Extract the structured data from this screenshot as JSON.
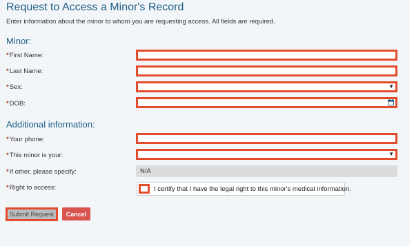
{
  "page": {
    "title": "Request to Access a Minor's Record",
    "intro": "Enter information about the minor to whom you are requesting access. All fields are required."
  },
  "minor_section": {
    "title": "Minor:",
    "required_mark": "*",
    "first_name_label": "First Name:",
    "first_name_value": "",
    "last_name_label": "Last Name:",
    "last_name_value": "",
    "sex_label": "Sex:",
    "sex_value": "",
    "dob_label": "DOB:",
    "dob_value": ""
  },
  "additional_section": {
    "title": "Additional information:",
    "your_phone_label": "Your phone:",
    "your_phone_value": "",
    "relationship_label": "This minor is your:",
    "relationship_value": "",
    "other_label": "If other, please specify:",
    "other_value": "N/A",
    "right_label": "Right to access:",
    "certify_text": "I certify that I have the legal right to this minor's medical information.",
    "certify_checked": false
  },
  "buttons": {
    "submit": "Submit Request",
    "cancel": "Cancel"
  },
  "icons": {
    "select": "chevron-down-icon",
    "dob": "calendar-icon"
  },
  "colors": {
    "heading": "#1f5e85",
    "required": "#c0392b",
    "highlight_border": "#e24b2b",
    "cancel": "#d9534f",
    "submit_disabled": "#bdbdbd"
  }
}
